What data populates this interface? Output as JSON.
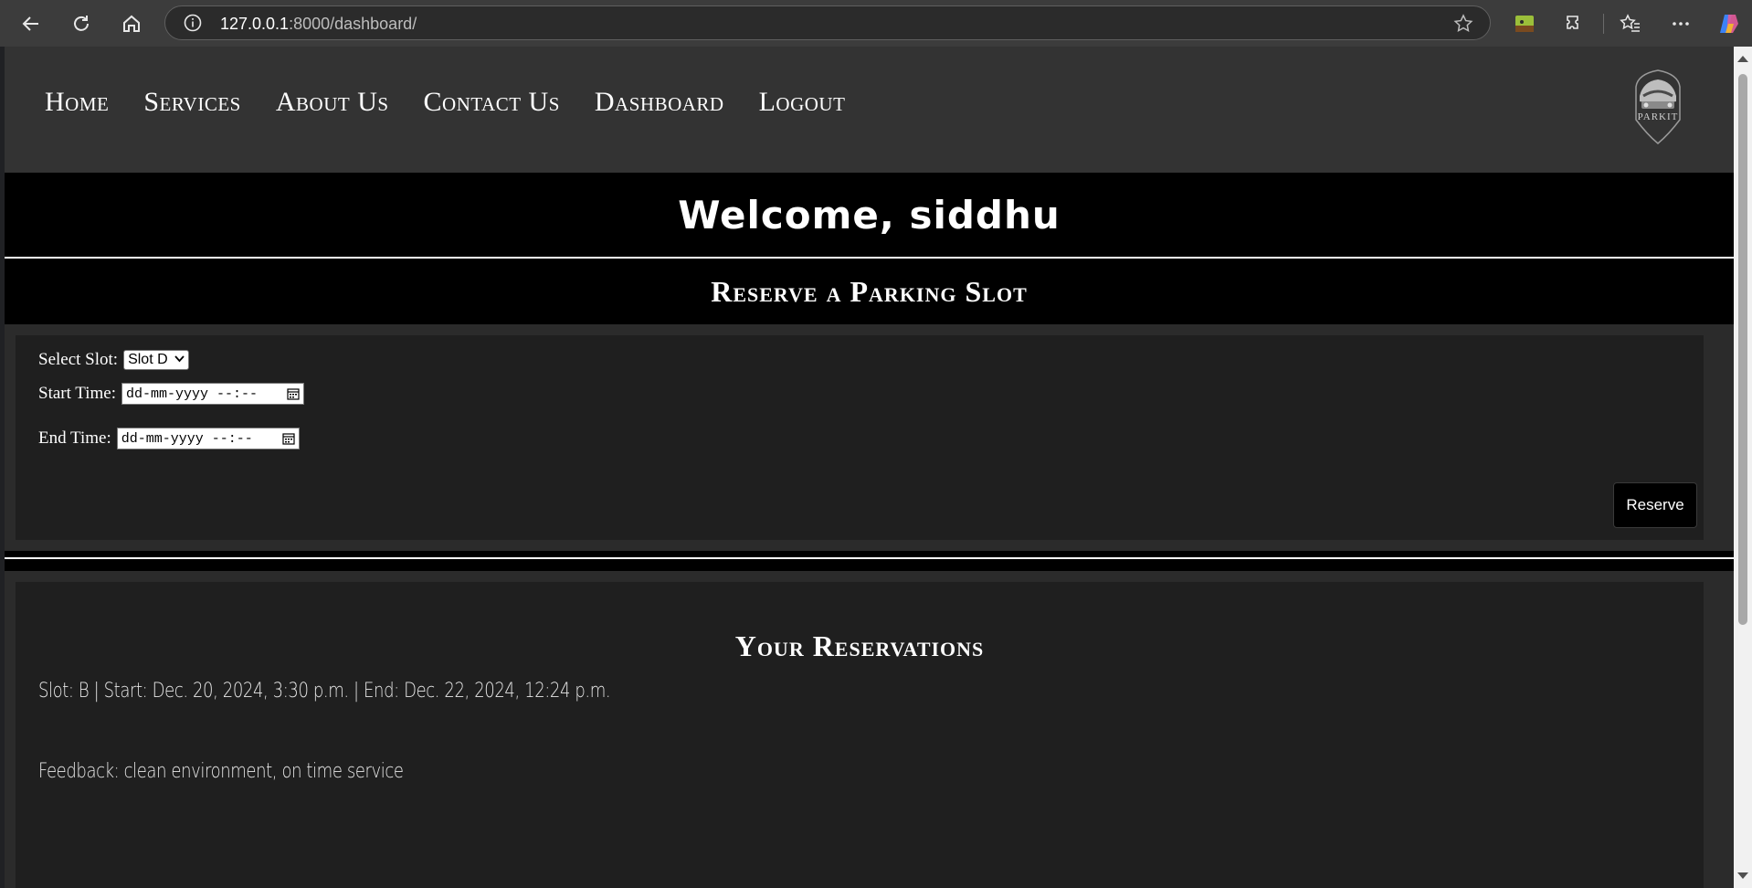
{
  "browser": {
    "url_host": "127.0.0.1",
    "url_rest": ":8000/dashboard/"
  },
  "nav": {
    "items": [
      "Home",
      "Services",
      "About Us",
      "Contact Us",
      "Dashboard",
      "Logout"
    ]
  },
  "logo": {
    "text": "PARKIT"
  },
  "welcome": {
    "title": "Welcome, siddhu"
  },
  "reserve": {
    "heading": "Reserve a Parking Slot",
    "slot_label": "Select Slot:",
    "slot_value": "Slot D",
    "start_label": "Start Time:",
    "start_placeholder": "dd-mm-yyyy --:--",
    "end_label": "End Time:",
    "end_placeholder": "dd-mm-yyyy --:--",
    "button": "Reserve"
  },
  "reservations": {
    "heading": "Your Reservations",
    "entry": "Slot: B | Start: Dec. 20, 2024, 3:30 p.m. | End: Dec. 22, 2024, 12:24 p.m.",
    "feedback": "Feedback: clean environment, on time service"
  },
  "colors": {
    "header_bg": "#333333",
    "band_bg": "#000000",
    "card_bg": "#1f1f1f",
    "text": "#ffffff"
  }
}
